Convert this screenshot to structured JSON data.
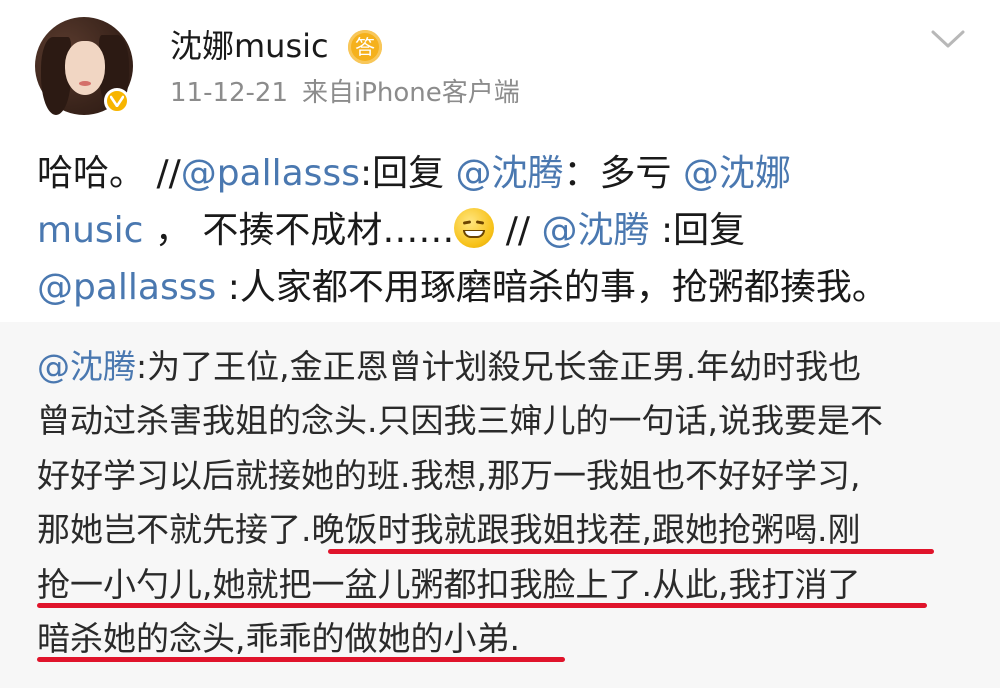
{
  "post": {
    "author": "沈娜music",
    "author_badge": "答",
    "date": "11-12-21",
    "source": "来自iPhone客户端",
    "text_parts": {
      "t1": "哈哈。 //",
      "m1": "@pallasss",
      "t2": ":回复 ",
      "m2": "@沈腾",
      "t3": "：多亏  ",
      "m3": "@沈娜",
      "m3b": "music",
      "t4": "  ，  不揍不成材……",
      "t5": " // ",
      "m4": "@沈腾",
      "t6": " :回复",
      "m5": "@pallasss",
      "t7": " :人家都不用琢磨暗杀的事，抢粥都揍我。"
    }
  },
  "quote": {
    "mention": "@沈腾",
    "lines": [
      ":为了王位,金正恩曾计划殺兄长金正男.年幼时我也",
      "曾动过杀害我姐的念头.只因我三婶儿的一句话,说我要是不",
      "好好学习以后就接她的班.我想,那万一我姐也不好好学习,",
      "那她岂不就先接了.晚饭时我就跟我姐找茬,跟她抢粥喝.刚",
      "抢一小勺儿,她就把一盆儿粥都扣我脸上了.从此,我打消了",
      "暗杀她的念头,乖乖的做她的小弟."
    ]
  },
  "colors": {
    "mention": "#4a78b0",
    "underline": "#e0142b",
    "quote_bg": "#f7f7f7",
    "meta": "#8c8c8c",
    "vip_badge": "#f7b500"
  },
  "icons": {
    "verified": "verified-v-icon",
    "menu": "chevron-down-icon",
    "emoji": "smirk-emoji-icon"
  }
}
